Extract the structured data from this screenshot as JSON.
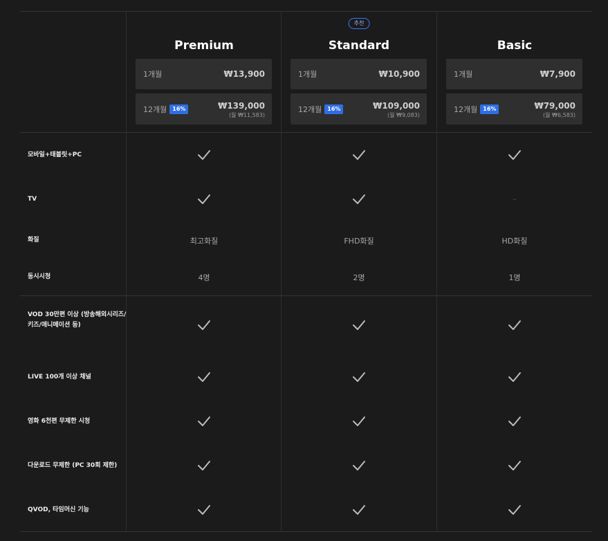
{
  "recommend_badge": "추천",
  "plans": [
    {
      "name": "Premium",
      "month1_label": "1개월",
      "month1_price": "₩13,900",
      "month12_label": "12개월",
      "discount": "16%",
      "month12_price": "₩139,000",
      "month12_sub": "(월 ₩11,583)"
    },
    {
      "name": "Standard",
      "month1_label": "1개월",
      "month1_price": "₩10,900",
      "month12_label": "12개월",
      "discount": "16%",
      "month12_price": "₩109,000",
      "month12_sub": "(월 ₩9,083)"
    },
    {
      "name": "Basic",
      "month1_label": "1개월",
      "month1_price": "₩7,900",
      "month12_label": "12개월",
      "discount": "16%",
      "month12_price": "₩79,000",
      "month12_sub": "(월 ₩6,583)"
    }
  ],
  "features": [
    {
      "label": "모바일+태블릿+PC",
      "values": [
        "check",
        "check",
        "check"
      ]
    },
    {
      "label": "TV",
      "values": [
        "check",
        "check",
        "–"
      ]
    },
    {
      "label": "화질",
      "values": [
        "최고화질",
        "FHD화질",
        "HD화질"
      ]
    },
    {
      "label": "동시시청",
      "values": [
        "4명",
        "2명",
        "1명"
      ]
    },
    {
      "label": "VOD 30만편 이상 (방송해외시리즈/키즈/애니메이션 등)",
      "values": [
        "check",
        "check",
        "check"
      ]
    },
    {
      "label": "LIVE 100개 이상 채널",
      "values": [
        "check",
        "check",
        "check"
      ]
    },
    {
      "label": "영화 6천편 무제한 시청",
      "values": [
        "check",
        "check",
        "check"
      ]
    },
    {
      "label": "다운로드 무제한 (PC 30회 제한)",
      "values": [
        "check",
        "check",
        "check"
      ]
    },
    {
      "label": "QVOD, 타임머신 기능",
      "values": [
        "check",
        "check",
        "check"
      ]
    }
  ],
  "icons": {
    "check": "check-icon"
  },
  "colors": {
    "accent": "#2f6fe6",
    "background": "#1b1b1b",
    "box": "#2f2f2f"
  }
}
